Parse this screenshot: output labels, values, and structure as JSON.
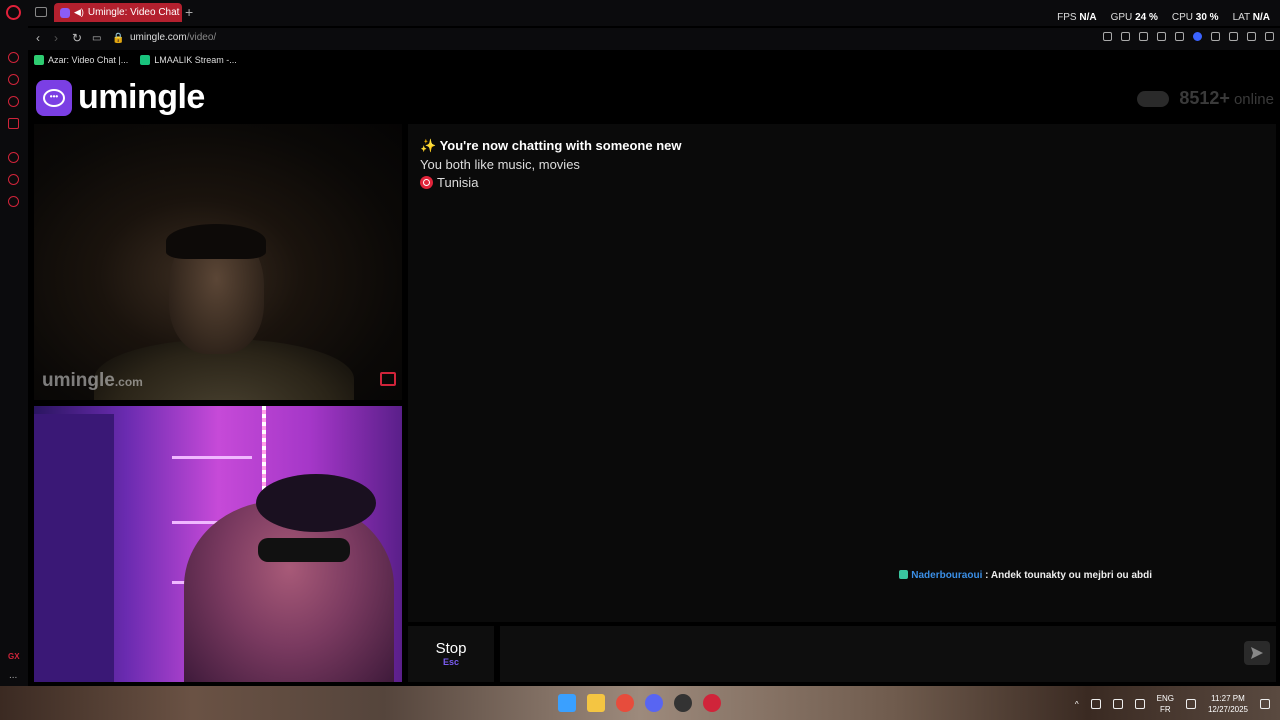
{
  "browser": {
    "tab_title": "Umingle: Video Chat w",
    "url_host": "umingle.com",
    "url_path": "/video/",
    "new_tab_symbol": "+",
    "perf": {
      "fps_label": "FPS",
      "fps_value": "N/A",
      "gpu_label": "GPU",
      "gpu_value": "24 %",
      "cpu_label": "CPU",
      "cpu_value": "30 %",
      "lat_label": "LAT",
      "lat_value": "N/A"
    },
    "bookmarks": [
      {
        "label": "Azar: Video Chat |...",
        "color": "#2ecc71"
      },
      {
        "label": "LMAALIK Stream -...",
        "color": "#19c37d"
      }
    ],
    "sidebar_gx": "GX",
    "sidebar_more": "..."
  },
  "page": {
    "brand_name": "umingle",
    "online_count": "8512+",
    "online_label": "online",
    "watermark_main": "umingle",
    "watermark_suffix": ".com",
    "chat": {
      "header_emoji": "✨",
      "header": "You're now chatting with someone new",
      "interests": "You both like music, movies",
      "country": "Tunisia",
      "message_user": "Naderbouraoui",
      "message_sep": " : ",
      "message_text": "Andek tounakty ou mejbri ou abdi"
    },
    "stop_label": "Stop",
    "stop_shortcut": "Esc",
    "input_placeholder": ""
  },
  "taskbar": {
    "lang_top": "ENG",
    "lang_bottom": "FR",
    "time": "11:27 PM",
    "date": "12/27/2025",
    "apps": [
      {
        "name": "windows-start-icon",
        "color": "#3aa0ff"
      },
      {
        "name": "file-explorer-icon",
        "color": "#f4c542"
      },
      {
        "name": "chrome-icon",
        "color": "#e74c3c"
      },
      {
        "name": "discord-icon",
        "color": "#5865f2"
      },
      {
        "name": "obs-icon",
        "color": "#333333"
      },
      {
        "name": "opera-gx-icon",
        "color": "#d0243a"
      }
    ]
  },
  "colors": {
    "accent": "#7b3fe4",
    "opera_red": "#d0243a",
    "username_blue": "#3b8fe6"
  }
}
